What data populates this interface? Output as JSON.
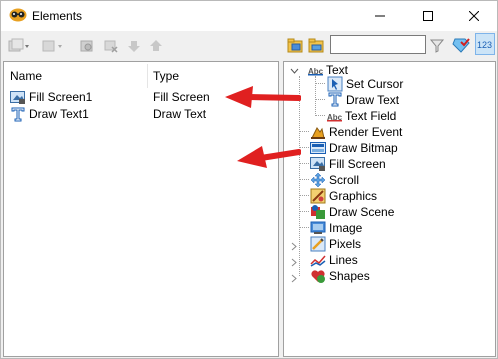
{
  "window": {
    "title": "Elements"
  },
  "left": {
    "columns": {
      "name": "Name",
      "type": "Type"
    },
    "rows": [
      {
        "name": "Fill Screen1",
        "type": "Fill Screen",
        "icon": "fill-screen-icon"
      },
      {
        "name": "Draw Text1",
        "type": "Draw Text",
        "icon": "draw-text-icon"
      }
    ],
    "toolbar": [
      "add-element-icon",
      "add-dropdown-icon",
      "copy-element-icon",
      "properties-icon",
      "delete-icon",
      "move-down-icon",
      "move-up-icon"
    ]
  },
  "right": {
    "search": {
      "value": "",
      "placeholder": ""
    },
    "toolbar_icons": [
      "expand-all-icon",
      "collapse-all-icon",
      "filter-icon",
      "favorite-icon",
      "sort-123-icon"
    ],
    "tree": [
      {
        "label": "Text",
        "icon": "text-abc-icon",
        "expanded": true
      },
      {
        "label": "Set Cursor",
        "icon": "set-cursor-icon",
        "child": true
      },
      {
        "label": "Draw Text",
        "icon": "draw-text-icon",
        "child": true
      },
      {
        "label": "Text Field",
        "icon": "text-field-icon",
        "child": true
      },
      {
        "label": "Render Event",
        "icon": "render-event-icon"
      },
      {
        "label": "Draw Bitmap",
        "icon": "draw-bitmap-icon"
      },
      {
        "label": "Fill Screen",
        "icon": "fill-screen-icon"
      },
      {
        "label": "Scroll",
        "icon": "scroll-icon"
      },
      {
        "label": "Graphics",
        "icon": "graphics-icon"
      },
      {
        "label": "Draw Scene",
        "icon": "draw-scene-icon"
      },
      {
        "label": "Image",
        "icon": "image-icon"
      },
      {
        "label": "Pixels",
        "icon": "pixels-icon",
        "collapsed": true
      },
      {
        "label": "Lines",
        "icon": "lines-icon",
        "collapsed": true
      },
      {
        "label": "Shapes",
        "icon": "shapes-icon",
        "collapsed": true
      }
    ]
  },
  "colors": {
    "accent_arrow": "#e02020",
    "text_icon_blue": "#1a5fb4"
  }
}
